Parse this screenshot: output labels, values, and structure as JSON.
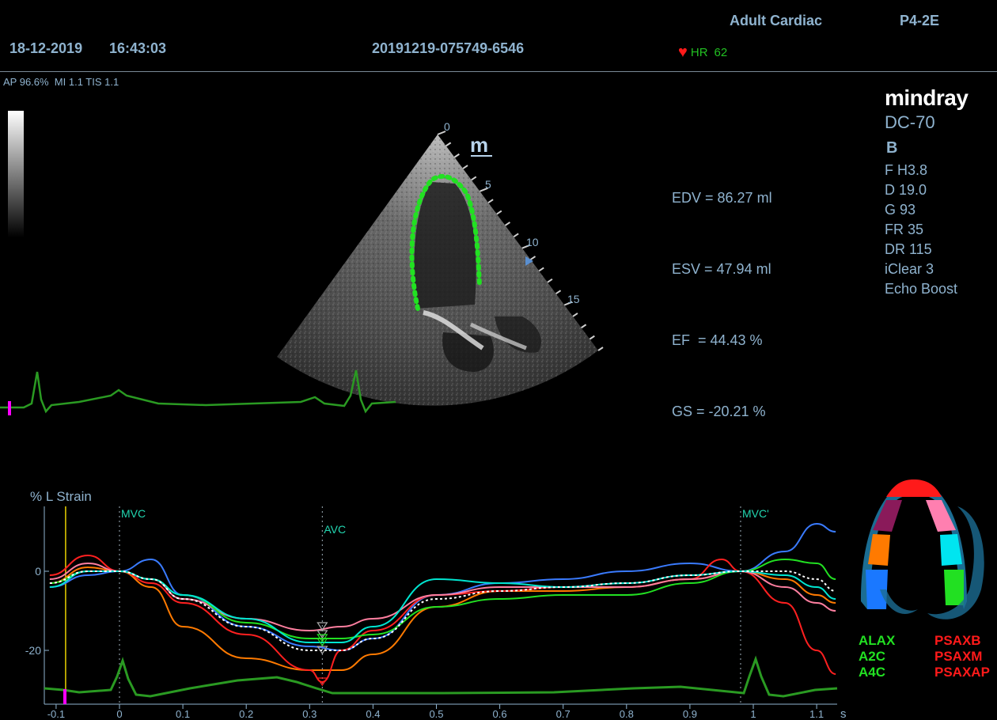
{
  "header": {
    "exam_type": "Adult Cardiac",
    "probe": "P4-2E",
    "date": "18-12-2019",
    "time": "16:43:03",
    "study_id": "20191219-075749-6546",
    "hr_label": "HR",
    "hr_value": "62",
    "acoustic": "AP 96.6%  MI 1.1 TIS 1.1"
  },
  "brand": {
    "logo": "mindray",
    "model": "DC-70",
    "mode": "B"
  },
  "image_params": [
    "F H3.8",
    "D 19.0",
    "G 93",
    "FR 35",
    "DR 115",
    "iClear 3",
    "Echo Boost"
  ],
  "measurements": {
    "edv": "EDV = 86.27 ml",
    "esv": "ESV = 47.94 ml",
    "ef": "EF  = 44.43 %",
    "gs": "GS = -20.21 %"
  },
  "depth_scale": [
    "0",
    "5",
    "10",
    "15"
  ],
  "probe_marker": "m",
  "strain": {
    "title": "% L Strain",
    "events": [
      "MVC",
      "AVC",
      "MVC'"
    ],
    "unit": "s"
  },
  "segment_legend": {
    "left": [
      "ALAX",
      "A2C",
      "A4C"
    ],
    "right": [
      "PSAXB",
      "PSAXM",
      "PSAXAP"
    ]
  },
  "chart_data": {
    "type": "line",
    "title": "",
    "ylabel": "% L Strain",
    "xlabel": "s",
    "xlim": [
      -0.11,
      1.13
    ],
    "ylim": [
      -30,
      15
    ],
    "x_ticks": [
      -0.1,
      0,
      0.1,
      0.2,
      0.3,
      0.4,
      0.5,
      0.6,
      0.7,
      0.8,
      0.9,
      1,
      1.1
    ],
    "x_tick_labels": [
      "-0.1",
      "0",
      "0.1",
      "0.2",
      "0.3",
      "0.4",
      "0.5",
      "0.6",
      "0.7",
      "0.8",
      "0.9",
      "1",
      "1.1"
    ],
    "y_ticks": [
      0,
      -20
    ],
    "y_tick_labels": [
      "0",
      "-20"
    ],
    "event_markers": [
      {
        "label": "MVC",
        "x": 0
      },
      {
        "label": "AVC",
        "x": 0.32
      },
      {
        "label": "MVC'",
        "x": 0.98
      }
    ],
    "cursor_x": -0.085,
    "series": [
      {
        "color": "#3a7bff",
        "x": [
          -0.11,
          -0.05,
          0,
          0.05,
          0.1,
          0.2,
          0.3,
          0.35,
          0.4,
          0.5,
          0.6,
          0.7,
          0.8,
          0.9,
          0.98,
          1.05,
          1.1,
          1.13
        ],
        "y": [
          -4,
          -1,
          0,
          3,
          -6,
          -14,
          -19,
          -20,
          -17,
          -6,
          -3,
          -2,
          0,
          2,
          0,
          5,
          12,
          10
        ]
      },
      {
        "color": "#ff7a00",
        "x": [
          -0.11,
          -0.05,
          0,
          0.05,
          0.1,
          0.2,
          0.3,
          0.35,
          0.4,
          0.5,
          0.6,
          0.7,
          0.8,
          0.9,
          0.98,
          1.05,
          1.1,
          1.13
        ],
        "y": [
          -3,
          1,
          0,
          -4,
          -14,
          -22,
          -25,
          -25,
          -21,
          -9,
          -5,
          -5,
          -4,
          -2,
          0,
          -2,
          -6,
          -8
        ]
      },
      {
        "color": "#ff2020",
        "x": [
          -0.11,
          -0.05,
          0,
          0.05,
          0.1,
          0.2,
          0.3,
          0.32,
          0.35,
          0.4,
          0.5,
          0.6,
          0.7,
          0.8,
          0.9,
          0.95,
          0.98,
          1.05,
          1.1,
          1.13
        ],
        "y": [
          -1,
          4,
          0,
          -3,
          -8,
          -16,
          -25,
          -28,
          -20,
          -15,
          -6,
          -5,
          -4,
          -4,
          -2,
          3,
          0,
          -8,
          -20,
          -26
        ]
      },
      {
        "color": "#ff7fa0",
        "x": [
          -0.11,
          -0.05,
          0,
          0.05,
          0.1,
          0.2,
          0.3,
          0.35,
          0.4,
          0.5,
          0.6,
          0.7,
          0.8,
          0.9,
          0.98,
          1.05,
          1.1,
          1.13
        ],
        "y": [
          -2,
          2,
          0,
          -2,
          -7,
          -12,
          -15,
          -14,
          -12,
          -6,
          -4,
          -4,
          -4,
          -2,
          0,
          -4,
          -8,
          -10
        ]
      },
      {
        "color": "#22e022",
        "x": [
          -0.11,
          -0.05,
          0,
          0.05,
          0.1,
          0.2,
          0.3,
          0.35,
          0.4,
          0.5,
          0.6,
          0.7,
          0.8,
          0.9,
          0.98,
          1.05,
          1.1,
          1.13
        ],
        "y": [
          -3,
          0,
          0,
          -2,
          -6,
          -13,
          -17,
          -17,
          -16,
          -9,
          -7,
          -6,
          -6,
          -3,
          0,
          3,
          2,
          -2
        ]
      },
      {
        "color": "#00e5d0",
        "x": [
          -0.11,
          -0.05,
          0,
          0.05,
          0.1,
          0.2,
          0.3,
          0.35,
          0.4,
          0.5,
          0.6,
          0.7,
          0.8,
          0.9,
          0.98,
          1.05,
          1.1,
          1.13
        ],
        "y": [
          -4,
          0,
          0,
          -2,
          -6,
          -12,
          -18,
          -18,
          -14,
          -2,
          -3,
          -4,
          -3,
          -1,
          0,
          -1,
          -4,
          -7
        ]
      },
      {
        "color": "#ffffff",
        "dashed": true,
        "x": [
          -0.11,
          -0.05,
          0,
          0.05,
          0.1,
          0.2,
          0.3,
          0.35,
          0.4,
          0.5,
          0.6,
          0.7,
          0.8,
          0.9,
          0.98,
          1.05,
          1.1,
          1.13
        ],
        "y": [
          -3,
          0,
          0,
          -2,
          -7,
          -14,
          -20,
          -20,
          -17,
          -7,
          -5,
          -4,
          -3,
          -1,
          0,
          0,
          -2,
          -5
        ]
      }
    ]
  },
  "colors": {
    "label": "#8fb3cf",
    "ecg": "#2a9a22",
    "contour": "#22e022",
    "accent_magenta": "#ff00ff",
    "cursor": "#e8d000"
  }
}
